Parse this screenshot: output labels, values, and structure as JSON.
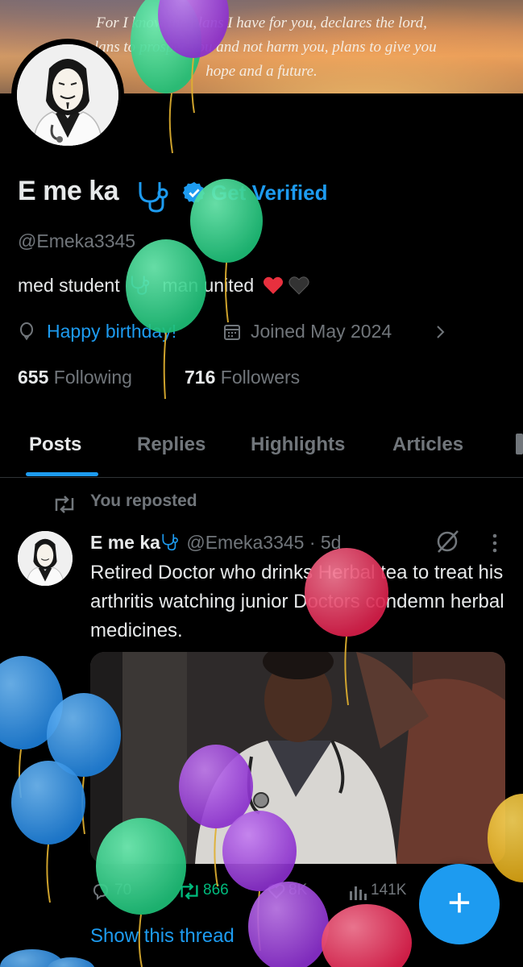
{
  "banner": {
    "verse_line1": "For I know the plans I have for you, declares the lord,",
    "verse_line2": "plans to prosper you and not harm you, plans to give you",
    "verse_line3": "hope and a future."
  },
  "profile": {
    "name": "E me ka",
    "name_emoji": "stethoscope-icon",
    "get_verified": "Get Verified",
    "handle": "@Emeka3345",
    "bio_part1": "med student",
    "bio_part2": "man united",
    "birthday": "Happy birthday!",
    "joined": "Joined May 2024",
    "following_count": "655",
    "following_label": "Following",
    "followers_count": "716",
    "followers_label": "Followers"
  },
  "tabs": [
    "Posts",
    "Replies",
    "Highlights",
    "Articles"
  ],
  "post": {
    "repost_label": "You reposted",
    "author_name": "E me ka",
    "author_handle": "@Emeka3345",
    "time": "· 5d",
    "text": "Retired Doctor who drinks Herbal tea to treat his arthritis watching junior Doctors condemn herbal medicines.",
    "replies": "70",
    "reposts": "866",
    "likes": "8K",
    "views": "141K",
    "show_thread": "Show this thread"
  },
  "fab": {
    "label": "+"
  },
  "colors": {
    "accent": "#1d9bf0",
    "balloon_green": "#2fd68b",
    "balloon_purple": "#9b3fd8",
    "balloon_blue": "#2b90e8",
    "balloon_red": "#e83a5e",
    "balloon_yellow": "#e8b820"
  }
}
